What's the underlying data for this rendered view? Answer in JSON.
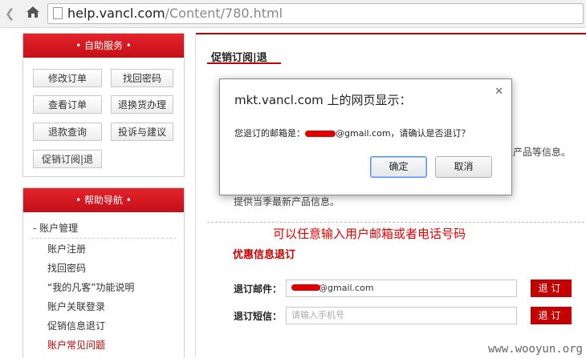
{
  "browser": {
    "url_host": "help.vancl.com",
    "url_path": "/Content/780.html"
  },
  "sidebar": {
    "service_title": "• 自助服务 •",
    "service_buttons": [
      "修改订单",
      "找回密码",
      "查看订单",
      "退换货办理",
      "退款查询",
      "投诉与建议",
      "促销订阅|退"
    ],
    "help_title": "• 帮助导航 •",
    "account_title": "- 账户管理",
    "account_links": [
      "账户注册",
      "找回密码",
      "“我的凡客”功能说明",
      "账户关联登录",
      "促销信息退订",
      "账户常见问题"
    ]
  },
  "main": {
    "title": "促销订阅|退",
    "bg_text_1": "的产品等信息。",
    "bg_text_2": "提供当季最新产品信息。",
    "annotation": "可以任意输入用户邮箱或者电话号码",
    "section_title": "优惠信息退订",
    "email_label": "退订邮件：",
    "email_value": "@gmail.com",
    "sms_label": "退订短信：",
    "sms_placeholder": "请输入手机号",
    "unsubscribe_button": "退订"
  },
  "dialog": {
    "title": "mkt.vancl.com 上的网页显示：",
    "message_prefix": "您退订的邮箱是：",
    "message_suffix": "@gmail.com，请确认是否退订？",
    "ok_label": "确定",
    "cancel_label": "取消"
  },
  "watermark": "www.wooyun.org",
  "colors": {
    "brand_red": "#c40000",
    "annotation_red": "#e60000",
    "focus_blue": "#4d90fe"
  }
}
